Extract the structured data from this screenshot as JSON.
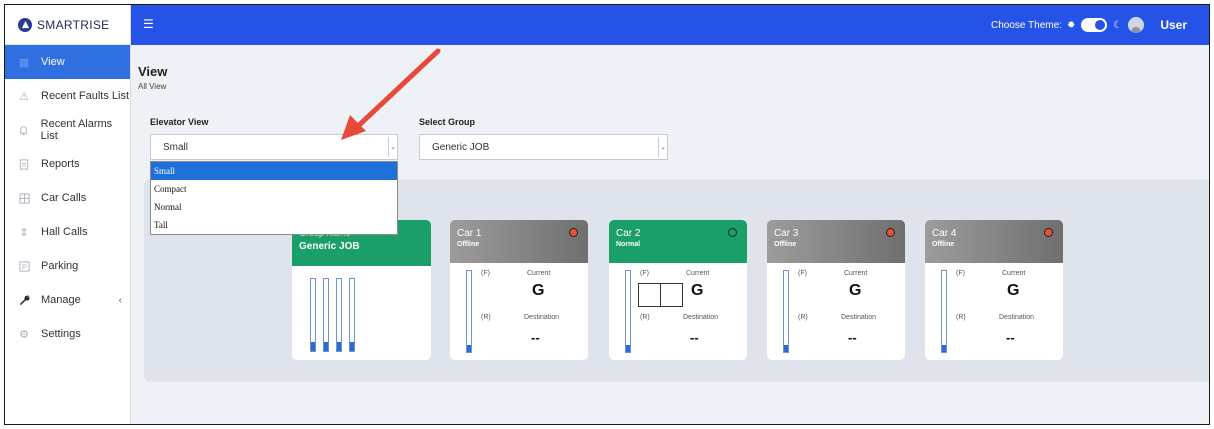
{
  "brand": {
    "name": "SMARTRISE"
  },
  "sidebar": {
    "items": [
      {
        "label": "View",
        "icon": "grid-icon",
        "active": true
      },
      {
        "label": "Recent Faults List",
        "icon": "warning-icon"
      },
      {
        "label": "Recent Alarms List",
        "icon": "bell-icon"
      },
      {
        "label": "Reports",
        "icon": "document-icon"
      },
      {
        "label": "Car Calls",
        "icon": "keypad-icon"
      },
      {
        "label": "Hall Calls",
        "icon": "arrows-icon"
      },
      {
        "label": "Parking",
        "icon": "parking-icon"
      },
      {
        "label": "Manage",
        "icon": "wrench-icon",
        "caret": "‹"
      },
      {
        "label": "Settings",
        "icon": "gear-icon"
      }
    ]
  },
  "topbar": {
    "menu_icon": "☰",
    "theme_label": "Choose Theme:",
    "sun_icon": "✹",
    "moon_icon": "☾",
    "user_label": "User"
  },
  "page": {
    "title": "View",
    "subtitle": "All View"
  },
  "elevator_view": {
    "label": "Elevator View",
    "value": "Small",
    "options": [
      "Small",
      "Compact",
      "Normal",
      "Tall"
    ],
    "selected_index": 0
  },
  "select_group": {
    "label": "Select Group",
    "value": "Generic JOB"
  },
  "group_card": {
    "label": "Group Name",
    "name": "Generic JOB",
    "shafts": [
      0.12,
      0.12,
      0.12,
      0.12
    ]
  },
  "cars": [
    {
      "name": "Car 1",
      "status": "Offline",
      "header": "gray",
      "light": "#e8542b",
      "front": "(F)",
      "rear": "(R)",
      "current_label": "Current",
      "current": "G",
      "destination_label": "Destination",
      "destination": "--",
      "level": 0.09,
      "doors": false
    },
    {
      "name": "Car 2",
      "status": "Normal",
      "header": "green",
      "light": "#1a9f6a",
      "front": "(F)",
      "rear": "(R)",
      "current_label": "Current",
      "current": "G",
      "destination_label": "Destination",
      "destination": "--",
      "level": 0.09,
      "doors": true
    },
    {
      "name": "Car 3",
      "status": "Offline",
      "header": "gray",
      "light": "#e8542b",
      "front": "(F)",
      "rear": "(R)",
      "current_label": "Current",
      "current": "G",
      "destination_label": "Destination",
      "destination": "--",
      "level": 0.09,
      "doors": false
    },
    {
      "name": "Car 4",
      "status": "Offline",
      "header": "gray",
      "light": "#e8542b",
      "front": "(F)",
      "rear": "(R)",
      "current_label": "Current",
      "current": "G",
      "destination_label": "Destination",
      "destination": "--",
      "level": 0.09,
      "doors": false
    }
  ],
  "colors": {
    "topbar": "#2553e8",
    "active_nav": "#2f6fe0",
    "annotation_arrow": "#e84a3a"
  }
}
